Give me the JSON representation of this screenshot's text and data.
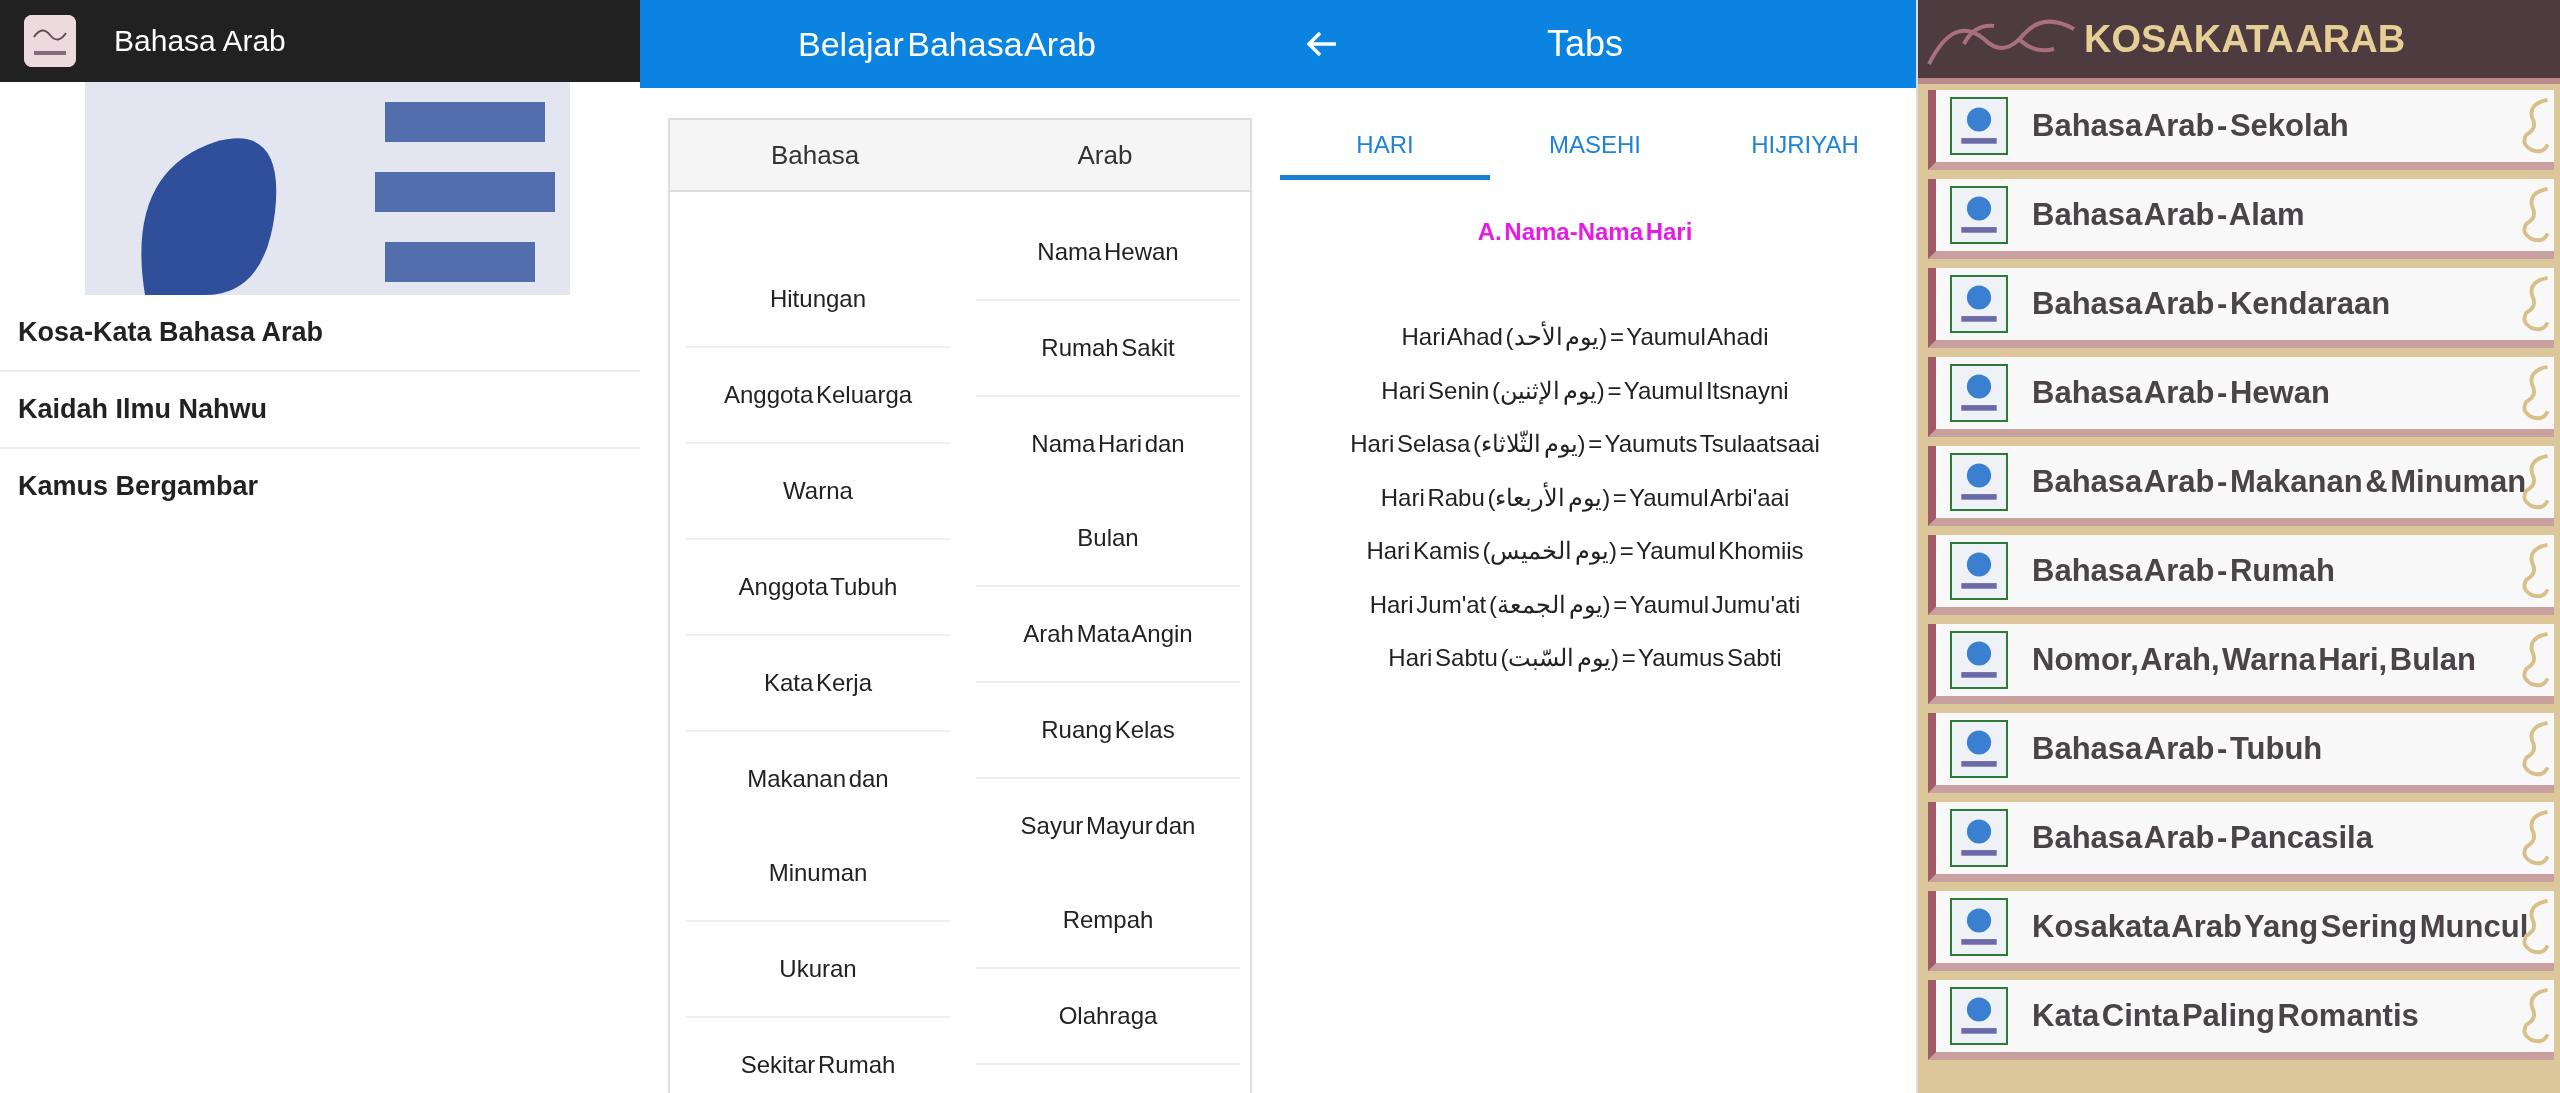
{
  "menu_app": {
    "title": "Bahasa Arab",
    "items": [
      {
        "label": "Kosa-Kata Bahasa Arab"
      },
      {
        "label": "Kaidah Ilmu Nahwu"
      },
      {
        "label": "Kamus Bergambar"
      }
    ]
  },
  "table_app": {
    "title": "Belajar Bahasa Arab",
    "columns": [
      {
        "header": "Bahasa",
        "cells": [
          [
            "Hitungan"
          ],
          [
            "Anggota Keluarga"
          ],
          [
            "Warna"
          ],
          [
            "Anggota Tubuh"
          ],
          [
            "Kata Kerja"
          ],
          [
            "Makanan dan",
            "Minuman"
          ],
          [
            "Ukuran"
          ],
          [
            "Sekitar Rumah"
          ]
        ]
      },
      {
        "header": "Arab",
        "cells": [
          [
            "Nama Hewan"
          ],
          [
            "Rumah Sakit"
          ],
          [
            "Nama Hari dan",
            "Bulan"
          ],
          [
            "Arah Mata Angin"
          ],
          [
            "Ruang Kelas"
          ],
          [
            "Sayur Mayur dan",
            "Rempah"
          ],
          [
            "Olahraga"
          ]
        ]
      }
    ]
  },
  "tabs_app": {
    "title": "Tabs",
    "tabs": [
      {
        "label": "HARI",
        "selected": true
      },
      {
        "label": "MASEHI",
        "selected": false
      },
      {
        "label": "HIJRIYAH",
        "selected": false
      }
    ],
    "heading": "A. Nama-Nama Hari",
    "lines": [
      "Hari Ahad (يوم الأحد) = Yaumul Ahadi",
      "Hari Senin (يوم الإثنين) = Yaumul Itsnayni",
      "Hari Selasa (يوم الثّلاثاء) = Yaumuts Tsulaatsaai",
      "Hari Rabu (يوم الأربعاء) = Yaumul Arbi'aai",
      "Hari Kamis (يوم الخميس) = Yaumul Khomiis",
      "Hari Jum'at (يوم الجمعة) = Yaumul Jumu'ati",
      "Hari Sabtu (يوم السّبت) = Yaumus Sabti"
    ]
  },
  "vocab_app": {
    "title": "KOSAKATA ARAB",
    "items": [
      {
        "label": "Bahasa Arab - Sekolah"
      },
      {
        "label": "Bahasa Arab - Alam"
      },
      {
        "label": "Bahasa Arab - Kendaraan"
      },
      {
        "label": "Bahasa Arab - Hewan"
      },
      {
        "label": "Bahasa Arab - Makanan & Minuman"
      },
      {
        "label": "Bahasa Arab - Rumah"
      },
      {
        "label": "Nomor, Arah, Warna Hari, Bulan"
      },
      {
        "label": "Bahasa Arab - Tubuh"
      },
      {
        "label": "Bahasa Arab - Pancasila"
      },
      {
        "label": "Kosakata Arab Yang Sering Muncul"
      },
      {
        "label": "Kata Cinta Paling Romantis"
      }
    ]
  }
}
